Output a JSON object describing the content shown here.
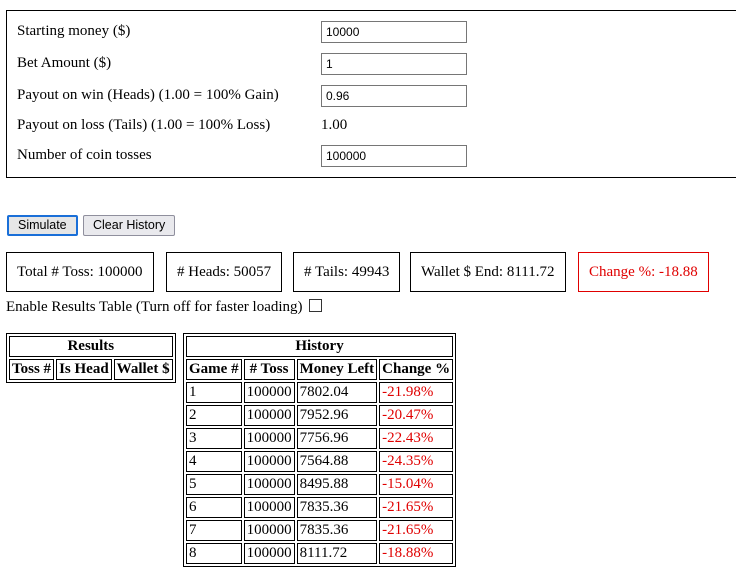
{
  "form": {
    "starting_money": {
      "label": "Starting money ($)",
      "value": "10000"
    },
    "bet_amount": {
      "label": "Bet Amount ($)",
      "value": "1"
    },
    "payout_win": {
      "label": "Payout on win (Heads) (1.00 = 100% Gain)",
      "value": "0.96"
    },
    "payout_loss": {
      "label": "Payout on loss (Tails) (1.00 = 100% Loss)",
      "value": "1.00"
    },
    "tosses": {
      "label": "Number of coin tosses",
      "value": "100000"
    }
  },
  "buttons": {
    "simulate": "Simulate",
    "clear_history": "Clear History"
  },
  "stats": {
    "total_toss": "Total # Toss: 100000",
    "heads": "# Heads: 50057",
    "tails": "# Tails: 49943",
    "wallet_end": "Wallet $ End: 8111.72",
    "change_pct": "Change %: -18.88"
  },
  "enable_results_label": "Enable Results Table (Turn off for faster loading)",
  "enable_results_checked": false,
  "results_table": {
    "title": "Results",
    "columns": [
      "Toss #",
      "Is Head",
      "Wallet $"
    ]
  },
  "history_table": {
    "title": "History",
    "columns": [
      "Game #",
      "# Toss",
      "Money Left",
      "Change %"
    ],
    "rows": [
      [
        "1",
        "100000",
        "7802.04",
        "-21.98%"
      ],
      [
        "2",
        "100000",
        "7952.96",
        "-20.47%"
      ],
      [
        "3",
        "100000",
        "7756.96",
        "-22.43%"
      ],
      [
        "4",
        "100000",
        "7564.88",
        "-24.35%"
      ],
      [
        "5",
        "100000",
        "8495.88",
        "-15.04%"
      ],
      [
        "6",
        "100000",
        "7835.36",
        "-21.65%"
      ],
      [
        "7",
        "100000",
        "7835.36",
        "-21.65%"
      ],
      [
        "8",
        "100000",
        "8111.72",
        "-18.88%"
      ]
    ]
  },
  "colors": {
    "negative": "#e00000",
    "button_focus": "#1a6fd8"
  }
}
